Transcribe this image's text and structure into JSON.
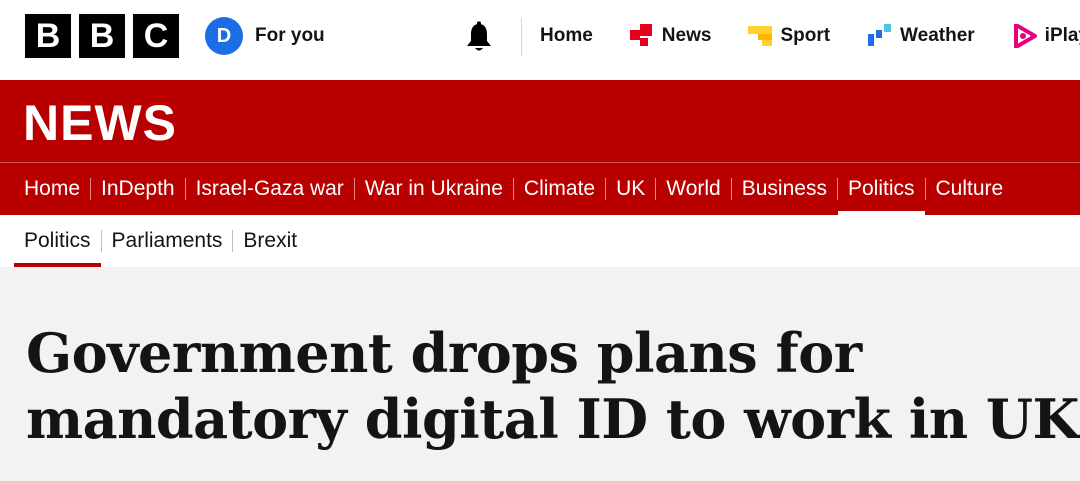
{
  "masthead": {
    "logo_letters": [
      "B",
      "B",
      "C"
    ],
    "account": {
      "initial": "D",
      "label": "For you"
    },
    "notifications_icon": "bell-icon",
    "nav": [
      {
        "label": "Home",
        "icon": ""
      },
      {
        "label": "News",
        "icon": "news-icon",
        "color": "#e6001e"
      },
      {
        "label": "Sport",
        "icon": "sport-icon",
        "color": "#ffd230"
      },
      {
        "label": "Weather",
        "icon": "weather-icon",
        "color": "#1d6ee6"
      },
      {
        "label": "iPlayer",
        "icon": "iplayer-icon",
        "color": "#e6007e"
      }
    ]
  },
  "news_band": {
    "title": "NEWS",
    "color": "#b80000",
    "sections": [
      "Home",
      "InDepth",
      "Israel-Gaza war",
      "War in Ukraine",
      "Climate",
      "UK",
      "World",
      "Business",
      "Politics",
      "Culture"
    ],
    "active_section": "Politics"
  },
  "sub_nav": {
    "items": [
      "Politics",
      "Parliaments",
      "Brexit"
    ],
    "active_item": "Politics"
  },
  "article": {
    "headline": "Government drops plans for mandatory digital ID to work in UK"
  }
}
